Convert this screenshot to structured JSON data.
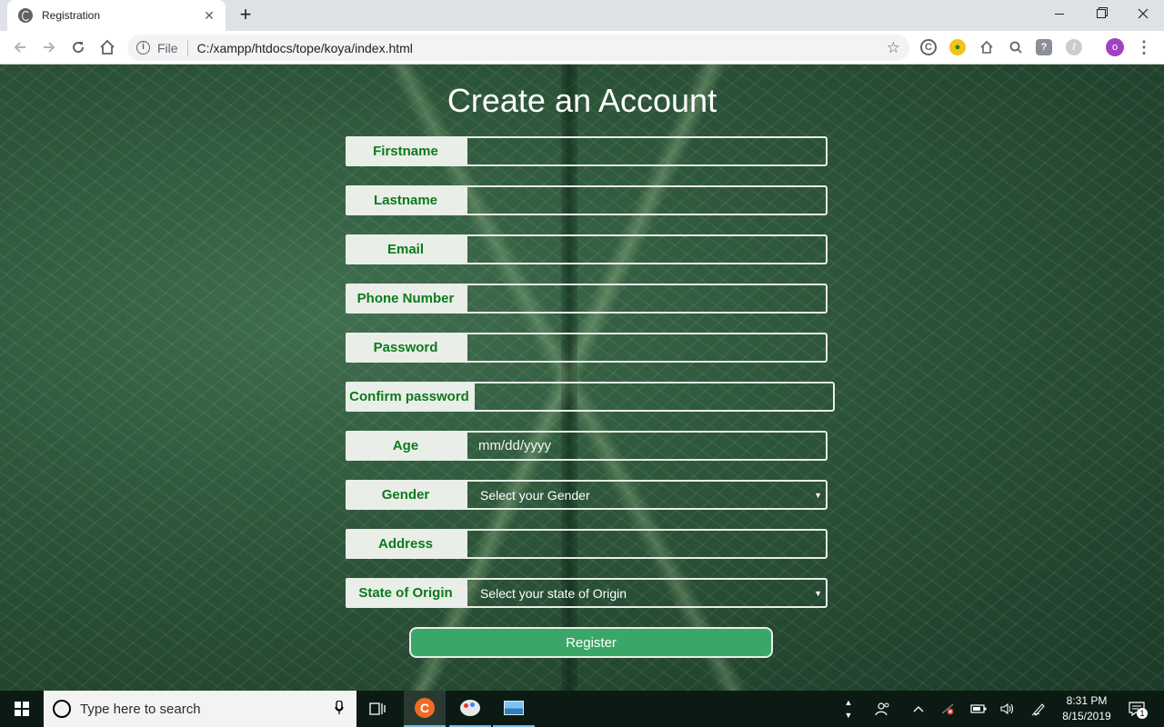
{
  "browser": {
    "tab_title": "Registration",
    "tab_close": "✕",
    "new_tab": "+",
    "scheme_label": "File",
    "url": "C:/xampp/htdocs/tope/koya/index.html",
    "profile_initial": "o"
  },
  "page": {
    "title": "Create an Account",
    "fields": {
      "firstname": {
        "label": "Firstname",
        "value": ""
      },
      "lastname": {
        "label": "Lastname",
        "value": ""
      },
      "email": {
        "label": "Email",
        "value": ""
      },
      "phone": {
        "label": "Phone Number",
        "value": ""
      },
      "password": {
        "label": "Password",
        "value": ""
      },
      "confirm_password": {
        "label": "Confirm password",
        "value": ""
      },
      "age": {
        "label": "Age",
        "placeholder": "mm/dd/yyyy"
      },
      "gender": {
        "label": "Gender",
        "selected": "Select your Gender"
      },
      "address": {
        "label": "Address",
        "value": ""
      },
      "state": {
        "label": "State of Origin",
        "selected": "Select your state of Origin"
      }
    },
    "register_label": "Register"
  },
  "taskbar": {
    "search_placeholder": "Type here to search",
    "time": "8:31 PM",
    "date": "8/15/2019",
    "notification_count": "1"
  },
  "colors": {
    "label_text": "#0c7a1c",
    "label_bg": "#e9eee8",
    "register_bg": "#3aa768"
  }
}
